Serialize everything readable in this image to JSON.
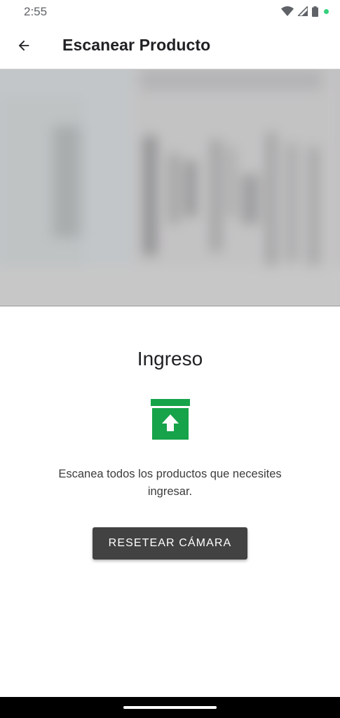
{
  "status_bar": {
    "time": "2:55",
    "icons": [
      "wifi-icon",
      "signal-icon",
      "battery-icon",
      "privacy-indicator-dot"
    ],
    "indicator_color": "#33d17a"
  },
  "app_bar": {
    "back_icon": "arrow-back-icon",
    "title": "Escanear Producto"
  },
  "camera": {
    "description_icon": "camera-preview"
  },
  "content": {
    "mode_title": "Ingreso",
    "mode_icon": "archive-upload-icon",
    "mode_icon_color": "#16a34a",
    "instruction": "Escanea todos los productos que necesites ingresar.",
    "reset_button_label": "RESETEAR CÁMARA",
    "reset_button_color": "#424242"
  },
  "nav_bar": {
    "handle": "gesture-handle"
  }
}
